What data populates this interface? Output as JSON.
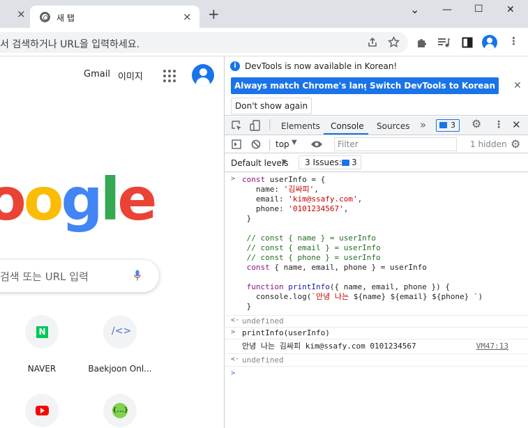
{
  "browser": {
    "prev_tab_close": "×",
    "tab": {
      "title": "새 탭",
      "close": "×"
    },
    "new_tab": "+",
    "window_controls": {
      "dropdown": "⌄",
      "minimize": "—",
      "maximize": "☐",
      "close": "✕"
    },
    "omnibox_placeholder": "서 검색하거나 URL을 입력하세요."
  },
  "ntp": {
    "gmail": "Gmail",
    "images": "이미지",
    "logo_letters": [
      "o",
      "o",
      "g",
      "l",
      "e"
    ],
    "logo_colors": [
      "#ea4335",
      "#fbbc05",
      "#4285f4",
      "#34a853",
      "#ea4335"
    ],
    "search_placeholder": "검색 또는 URL 입력",
    "shortcuts": [
      {
        "label": "NAVER",
        "icon": "naver-icon"
      },
      {
        "label": "Baekjoon Onl...",
        "icon": "code-brackets-icon"
      },
      {
        "label": "",
        "icon": "youtube-icon"
      },
      {
        "label": "",
        "icon": "code-braces-icon"
      }
    ]
  },
  "devtools": {
    "infobar": {
      "text": "DevTools is now available in Korean!",
      "btn_match": "Always match Chrome's language",
      "btn_switch": "Switch DevTools to Korean",
      "btn_dont_show": "Don't show again"
    },
    "tabs": [
      "Elements",
      "Console",
      "Sources"
    ],
    "active_tab": "Console",
    "more_tabs": "»",
    "messages_count": "3",
    "context": "top",
    "filter_placeholder": "Filter",
    "hidden": "1 hidden",
    "levels": "Default levels",
    "issues_label": "3 Issues:",
    "issues_count": "3"
  },
  "console": {
    "input1": [
      "const userInfo = {",
      "   name: '김싸피',",
      "   email: 'kim@ssafy.com',",
      "   phone: '0101234567',",
      " }",
      "",
      " // const { name } = userInfo",
      " // const { email } = userInfo",
      " // const { phone } = userInfo",
      " const { name, email, phone } = userInfo",
      "",
      " function printInfo({ name, email, phone }) {",
      "   console.log(`안녕 나는 ${name} ${email} ${phone} `)",
      " }"
    ],
    "result1": "undefined",
    "input2": "printInfo(userInfo)",
    "output2": "안녕 나는 김싸피 kim@ssafy.com 0101234567",
    "output2_source": "VM47:13",
    "result2": "undefined"
  }
}
